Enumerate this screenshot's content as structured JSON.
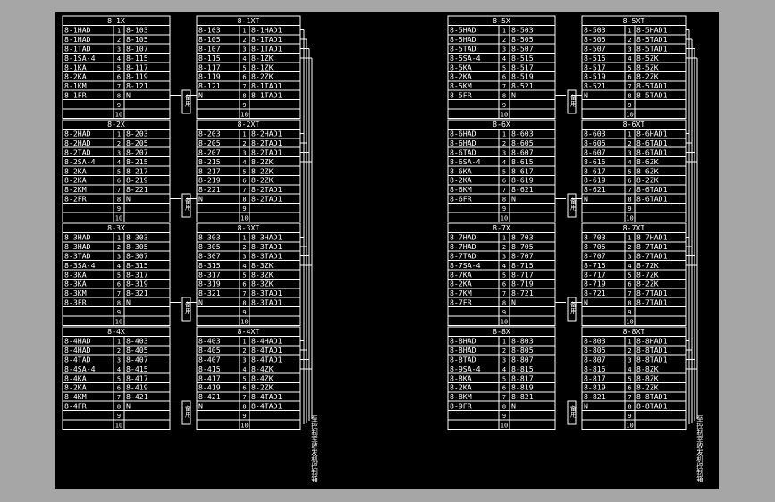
{
  "colors": {
    "background": "#000000",
    "line": "#ffffff",
    "text": "#ffffff",
    "frame": "#a6a6a6"
  },
  "left_panel": {
    "vertical_label": "至控制室收发机控制箱",
    "groups": [
      {
        "x_title": "8-1X",
        "xt_title": "8-1XT",
        "side_label": "备用",
        "rows": [
          {
            "dev": "8-1HAD",
            "n": "1",
            "x": "8-103",
            "xt_w": "8-103",
            "xt_n": "1",
            "xt_t": "8-1HAD1"
          },
          {
            "dev": "8-1HAD",
            "n": "2",
            "x": "8-105",
            "xt_w": "8-105",
            "xt_n": "2",
            "xt_t": "8-1TAD1"
          },
          {
            "dev": "8-1TAD",
            "n": "3",
            "x": "8-107",
            "xt_w": "8-107",
            "xt_n": "3",
            "xt_t": "8-1TAD1"
          },
          {
            "dev": "8-1SA-4",
            "n": "4",
            "x": "8-115",
            "xt_w": "8-115",
            "xt_n": "4",
            "xt_t": "8-1ZK"
          },
          {
            "dev": "8-1KA",
            "n": "5",
            "x": "8-117",
            "xt_w": "8-117",
            "xt_n": "5",
            "xt_t": "8-1ZK"
          },
          {
            "dev": "8-2KA",
            "n": "6",
            "x": "8-119",
            "xt_w": "8-119",
            "xt_n": "6",
            "xt_t": "8-2ZK"
          },
          {
            "dev": "8-1KM",
            "n": "7",
            "x": "8-121",
            "xt_w": "8-121",
            "xt_n": "7",
            "xt_t": "8-1TAD1"
          },
          {
            "dev": "8-1FR",
            "n": "8",
            "x": "N",
            "xt_w": "N",
            "xt_n": "8",
            "xt_t": "8-1TAD1"
          },
          {
            "dev": "",
            "n": "9",
            "x": "",
            "xt_w": "",
            "xt_n": "9",
            "xt_t": ""
          },
          {
            "dev": "",
            "n": "10",
            "x": "",
            "xt_w": "",
            "xt_n": "10",
            "xt_t": ""
          }
        ]
      },
      {
        "x_title": "8-2X",
        "xt_title": "8-2XT",
        "side_label": "备用",
        "rows": [
          {
            "dev": "8-2HAD",
            "n": "1",
            "x": "8-203",
            "xt_w": "8-203",
            "xt_n": "1",
            "xt_t": "8-2HAD1"
          },
          {
            "dev": "8-2HAD",
            "n": "2",
            "x": "8-205",
            "xt_w": "8-205",
            "xt_n": "2",
            "xt_t": "8-2TAD1"
          },
          {
            "dev": "8-2TAD",
            "n": "3",
            "x": "8-207",
            "xt_w": "8-207",
            "xt_n": "3",
            "xt_t": "8-2TAD1"
          },
          {
            "dev": "8-2SA-4",
            "n": "4",
            "x": "8-215",
            "xt_w": "8-215",
            "xt_n": "4",
            "xt_t": "8-2ZK"
          },
          {
            "dev": "8-2KA",
            "n": "5",
            "x": "8-217",
            "xt_w": "8-217",
            "xt_n": "5",
            "xt_t": "8-2ZK"
          },
          {
            "dev": "8-2KA",
            "n": "6",
            "x": "8-219",
            "xt_w": "8-219",
            "xt_n": "6",
            "xt_t": "8-2ZK"
          },
          {
            "dev": "8-2KM",
            "n": "7",
            "x": "8-221",
            "xt_w": "8-221",
            "xt_n": "7",
            "xt_t": "8-2TAD1"
          },
          {
            "dev": "8-2FR",
            "n": "8",
            "x": "N",
            "xt_w": "N",
            "xt_n": "8",
            "xt_t": "8-2TAD1"
          },
          {
            "dev": "",
            "n": "9",
            "x": "",
            "xt_w": "",
            "xt_n": "9",
            "xt_t": ""
          },
          {
            "dev": "",
            "n": "10",
            "x": "",
            "xt_w": "",
            "xt_n": "10",
            "xt_t": ""
          }
        ]
      },
      {
        "x_title": "8-3X",
        "xt_title": "8-3XT",
        "side_label": "备用",
        "rows": [
          {
            "dev": "8-3HAD",
            "n": "1",
            "x": "8-303",
            "xt_w": "8-303",
            "xt_n": "1",
            "xt_t": "8-3HAD1"
          },
          {
            "dev": "8-3HAD",
            "n": "2",
            "x": "8-305",
            "xt_w": "8-305",
            "xt_n": "2",
            "xt_t": "8-3TAD1"
          },
          {
            "dev": "8-3TAD",
            "n": "3",
            "x": "8-307",
            "xt_w": "8-307",
            "xt_n": "3",
            "xt_t": "8-3TAD1"
          },
          {
            "dev": "8-3SA-4",
            "n": "4",
            "x": "8-315",
            "xt_w": "8-315",
            "xt_n": "4",
            "xt_t": "8-3ZK"
          },
          {
            "dev": "8-3KA",
            "n": "5",
            "x": "8-317",
            "xt_w": "8-317",
            "xt_n": "5",
            "xt_t": "8-3ZK"
          },
          {
            "dev": "8-3KA",
            "n": "6",
            "x": "8-319",
            "xt_w": "8-319",
            "xt_n": "6",
            "xt_t": "8-3ZK"
          },
          {
            "dev": "8-3KM",
            "n": "7",
            "x": "8-321",
            "xt_w": "8-321",
            "xt_n": "7",
            "xt_t": "8-3TAD1"
          },
          {
            "dev": "8-3FR",
            "n": "8",
            "x": "N",
            "xt_w": "N",
            "xt_n": "8",
            "xt_t": "8-3TAD1"
          },
          {
            "dev": "",
            "n": "9",
            "x": "",
            "xt_w": "",
            "xt_n": "9",
            "xt_t": ""
          },
          {
            "dev": "",
            "n": "10",
            "x": "",
            "xt_w": "",
            "xt_n": "10",
            "xt_t": ""
          }
        ]
      },
      {
        "x_title": "8-4X",
        "xt_title": "8-4XT",
        "side_label": "备用",
        "rows": [
          {
            "dev": "8-4HAD",
            "n": "1",
            "x": "8-403",
            "xt_w": "8-403",
            "xt_n": "1",
            "xt_t": "8-4HAD1"
          },
          {
            "dev": "8-4HAD",
            "n": "2",
            "x": "8-405",
            "xt_w": "8-405",
            "xt_n": "2",
            "xt_t": "8-4TAD1"
          },
          {
            "dev": "8-4TAD",
            "n": "3",
            "x": "8-407",
            "xt_w": "8-407",
            "xt_n": "3",
            "xt_t": "8-4TAD1"
          },
          {
            "dev": "8-4SA-4",
            "n": "4",
            "x": "8-415",
            "xt_w": "8-415",
            "xt_n": "4",
            "xt_t": "8-4ZK"
          },
          {
            "dev": "8-4KA",
            "n": "5",
            "x": "8-417",
            "xt_w": "8-417",
            "xt_n": "5",
            "xt_t": "8-4ZK"
          },
          {
            "dev": "8-2KA",
            "n": "6",
            "x": "8-419",
            "xt_w": "8-419",
            "xt_n": "6",
            "xt_t": "8-2ZK"
          },
          {
            "dev": "8-4KM",
            "n": "7",
            "x": "8-421",
            "xt_w": "8-421",
            "xt_n": "7",
            "xt_t": "8-4TAD1"
          },
          {
            "dev": "8-4FR",
            "n": "8",
            "x": "N",
            "xt_w": "N",
            "xt_n": "8",
            "xt_t": "8-4TAD1"
          },
          {
            "dev": "",
            "n": "9",
            "x": "",
            "xt_w": "",
            "xt_n": "9",
            "xt_t": ""
          },
          {
            "dev": "",
            "n": "10",
            "x": "",
            "xt_w": "",
            "xt_n": "10",
            "xt_t": ""
          }
        ]
      }
    ]
  },
  "right_panel": {
    "vertical_label": "至控制室收发机控制箱",
    "groups": [
      {
        "x_title": "8-5X",
        "xt_title": "8-5XT",
        "side_label": "备用",
        "rows": [
          {
            "dev": "8-5HAD",
            "n": "1",
            "x": "8-503",
            "xt_w": "8-503",
            "xt_n": "1",
            "xt_t": "8-5HAD1"
          },
          {
            "dev": "8-5HAD",
            "n": "2",
            "x": "8-505",
            "xt_w": "8-505",
            "xt_n": "2",
            "xt_t": "8-5TAD1"
          },
          {
            "dev": "8-5TAD",
            "n": "3",
            "x": "8-507",
            "xt_w": "8-507",
            "xt_n": "3",
            "xt_t": "8-5TAD1"
          },
          {
            "dev": "8-5SA-4",
            "n": "4",
            "x": "8-515",
            "xt_w": "8-515",
            "xt_n": "4",
            "xt_t": "8-5ZK"
          },
          {
            "dev": "8-5KA",
            "n": "5",
            "x": "8-517",
            "xt_w": "8-517",
            "xt_n": "5",
            "xt_t": "8-5ZK"
          },
          {
            "dev": "8-2KA",
            "n": "6",
            "x": "8-519",
            "xt_w": "8-519",
            "xt_n": "6",
            "xt_t": "8-2ZK"
          },
          {
            "dev": "8-5KM",
            "n": "7",
            "x": "8-521",
            "xt_w": "8-521",
            "xt_n": "7",
            "xt_t": "8-5TAD1"
          },
          {
            "dev": "8-5FR",
            "n": "8",
            "x": "N",
            "xt_w": "N",
            "xt_n": "8",
            "xt_t": "8-5TAD1"
          },
          {
            "dev": "",
            "n": "9",
            "x": "",
            "xt_w": "",
            "xt_n": "9",
            "xt_t": ""
          },
          {
            "dev": "",
            "n": "10",
            "x": "",
            "xt_w": "",
            "xt_n": "10",
            "xt_t": ""
          }
        ]
      },
      {
        "x_title": "8-6X",
        "xt_title": "8-6XT",
        "side_label": "备用",
        "rows": [
          {
            "dev": "8-6HAD",
            "n": "1",
            "x": "8-603",
            "xt_w": "8-603",
            "xt_n": "1",
            "xt_t": "8-6HAD1"
          },
          {
            "dev": "8-6HAD",
            "n": "2",
            "x": "8-605",
            "xt_w": "8-605",
            "xt_n": "2",
            "xt_t": "8-6TAD1"
          },
          {
            "dev": "8-6TAD",
            "n": "3",
            "x": "8-607",
            "xt_w": "8-607",
            "xt_n": "3",
            "xt_t": "8-6TAD1"
          },
          {
            "dev": "8-6SA-4",
            "n": "4",
            "x": "8-615",
            "xt_w": "8-615",
            "xt_n": "4",
            "xt_t": "8-6ZK"
          },
          {
            "dev": "8-6KA",
            "n": "5",
            "x": "8-617",
            "xt_w": "8-617",
            "xt_n": "5",
            "xt_t": "8-6ZK"
          },
          {
            "dev": "8-2KA",
            "n": "6",
            "x": "8-619",
            "xt_w": "8-619",
            "xt_n": "6",
            "xt_t": "8-2ZK"
          },
          {
            "dev": "8-6KM",
            "n": "7",
            "x": "8-621",
            "xt_w": "8-621",
            "xt_n": "7",
            "xt_t": "8-6TAD1"
          },
          {
            "dev": "8-6FR",
            "n": "8",
            "x": "N",
            "xt_w": "N",
            "xt_n": "8",
            "xt_t": "8-6TAD1"
          },
          {
            "dev": "",
            "n": "9",
            "x": "",
            "xt_w": "",
            "xt_n": "9",
            "xt_t": ""
          },
          {
            "dev": "",
            "n": "10",
            "x": "",
            "xt_w": "",
            "xt_n": "10",
            "xt_t": ""
          }
        ]
      },
      {
        "x_title": "8-7X",
        "xt_title": "8-7XT",
        "side_label": "备用",
        "rows": [
          {
            "dev": "8-7HAD",
            "n": "1",
            "x": "8-703",
            "xt_w": "8-703",
            "xt_n": "1",
            "xt_t": "8-7HAD1"
          },
          {
            "dev": "8-7HAD",
            "n": "2",
            "x": "8-705",
            "xt_w": "8-705",
            "xt_n": "2",
            "xt_t": "8-7TAD1"
          },
          {
            "dev": "8-7TAD",
            "n": "3",
            "x": "8-707",
            "xt_w": "8-707",
            "xt_n": "3",
            "xt_t": "8-7TAD1"
          },
          {
            "dev": "8-7SA-4",
            "n": "4",
            "x": "8-715",
            "xt_w": "8-715",
            "xt_n": "4",
            "xt_t": "8-7ZK"
          },
          {
            "dev": "8-7KA",
            "n": "5",
            "x": "8-717",
            "xt_w": "8-717",
            "xt_n": "5",
            "xt_t": "8-7ZK"
          },
          {
            "dev": "8-2KA",
            "n": "6",
            "x": "8-719",
            "xt_w": "8-719",
            "xt_n": "6",
            "xt_t": "8-2ZK"
          },
          {
            "dev": "8-7KM",
            "n": "7",
            "x": "8-721",
            "xt_w": "8-721",
            "xt_n": "7",
            "xt_t": "8-7TAD1"
          },
          {
            "dev": "8-7FR",
            "n": "8",
            "x": "N",
            "xt_w": "N",
            "xt_n": "8",
            "xt_t": "8-7TAD1"
          },
          {
            "dev": "",
            "n": "9",
            "x": "",
            "xt_w": "",
            "xt_n": "9",
            "xt_t": ""
          },
          {
            "dev": "",
            "n": "10",
            "x": "",
            "xt_w": "",
            "xt_n": "10",
            "xt_t": ""
          }
        ]
      },
      {
        "x_title": "8-8X",
        "xt_title": "8-8XT",
        "side_label": "备用",
        "rows": [
          {
            "dev": "8-8HAD",
            "n": "1",
            "x": "8-803",
            "xt_w": "8-803",
            "xt_n": "1",
            "xt_t": "8-8HAD1"
          },
          {
            "dev": "8-8HAD",
            "n": "2",
            "x": "8-805",
            "xt_w": "8-805",
            "xt_n": "2",
            "xt_t": "8-8TAD1"
          },
          {
            "dev": "8-8TAD",
            "n": "3",
            "x": "8-807",
            "xt_w": "8-807",
            "xt_n": "3",
            "xt_t": "8-8TAD1"
          },
          {
            "dev": "8-9SA-4",
            "n": "4",
            "x": "8-815",
            "xt_w": "8-815",
            "xt_n": "4",
            "xt_t": "8-8ZK"
          },
          {
            "dev": "8-8KA",
            "n": "5",
            "x": "8-817",
            "xt_w": "8-817",
            "xt_n": "5",
            "xt_t": "8-8ZK"
          },
          {
            "dev": "8-2KA",
            "n": "6",
            "x": "8-819",
            "xt_w": "8-819",
            "xt_n": "6",
            "xt_t": "8-2ZK"
          },
          {
            "dev": "8-8KM",
            "n": "7",
            "x": "8-821",
            "xt_w": "8-821",
            "xt_n": "7",
            "xt_t": "8-8TAD1"
          },
          {
            "dev": "8-9FR",
            "n": "8",
            "x": "N",
            "xt_w": "N",
            "xt_n": "8",
            "xt_t": "8-8TAD1"
          },
          {
            "dev": "",
            "n": "9",
            "x": "",
            "xt_w": "",
            "xt_n": "9",
            "xt_t": ""
          },
          {
            "dev": "",
            "n": "10",
            "x": "",
            "xt_w": "",
            "xt_n": "10",
            "xt_t": ""
          }
        ]
      }
    ]
  }
}
